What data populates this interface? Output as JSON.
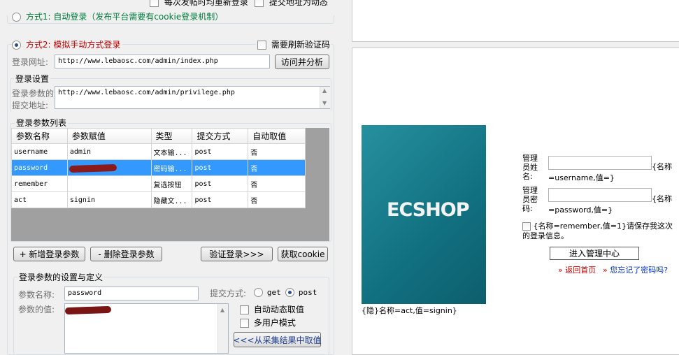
{
  "top": {
    "check1_label": "每次发帖时均重新登录",
    "check2_label": "提交地址为动态"
  },
  "method1": {
    "label": "方式1: 自动登录（发布平台需要有cookie登录机制）"
  },
  "method2": {
    "label": "方式2: 模拟手动方式登录",
    "refresh_captcha_label": "需要刷新验证码",
    "login_url_label": "登录网址:",
    "login_url_value": "http://www.lebaosc.com/admin/index.php",
    "visit_button": "访问并分析"
  },
  "login_settings": {
    "title": "登录设置",
    "submit_url_label_line1": "登录参数的",
    "submit_url_label_line2": "提交地址:",
    "submit_url_value": "http://www.lebaosc.com/admin/privilege.php"
  },
  "params_list": {
    "title": "登录参数列表",
    "columns": [
      "参数名称",
      "参数赋值",
      "类型",
      "提交方式",
      "自动取值"
    ],
    "rows": [
      {
        "name": "username",
        "value": "admin",
        "type": "文本输...",
        "method": "post",
        "auto": "否",
        "selected": false
      },
      {
        "name": "password",
        "value": "",
        "type": "密码输...",
        "method": "post",
        "auto": "否",
        "selected": true
      },
      {
        "name": "remember",
        "value": "",
        "type": "复选按钮",
        "method": "post",
        "auto": "否",
        "selected": false
      },
      {
        "name": "act",
        "value": "signin",
        "type": "隐藏文...",
        "method": "post",
        "auto": "否",
        "selected": false
      }
    ]
  },
  "actions": {
    "add_button": "+ 新增登录参数",
    "delete_button": "- 删除登录参数",
    "verify_button": "验证登录>>>",
    "cookie_button": "获取cookie"
  },
  "param_def": {
    "title": "登录参数的设置与定义",
    "name_label": "参数名称:",
    "name_value": "password",
    "method_label": "提交方式:",
    "get_label": "get",
    "post_label": "post",
    "value_label": "参数的值:",
    "auto_dynamic_label": "自动动态取值",
    "multi_user_label": "多用户模式",
    "from_results_button": "<<<从采集结果中取值"
  },
  "webpage": {
    "logo_text": "ECSHOP",
    "hidden_field_label": "{隐}名称=act,值=signin}",
    "username_label": "管理员姓名:",
    "username_hint_1": "{名称",
    "username_hint_2": "=username,值=}",
    "password_label": "管理员密码:",
    "password_hint_1": "{名称",
    "password_hint_2": "=password,值=}",
    "remember_text": "{名称=remember,值=1}请保存我这次的登录信息。",
    "submit_button": "进入管理中心",
    "home_link": "返回首页",
    "forgot_link": "您忘记了密码吗?"
  },
  "colors": {
    "selection": "#3399ff",
    "method_red": "#c00000",
    "method_green": "#007a3d",
    "logo_bg": "#117080"
  }
}
